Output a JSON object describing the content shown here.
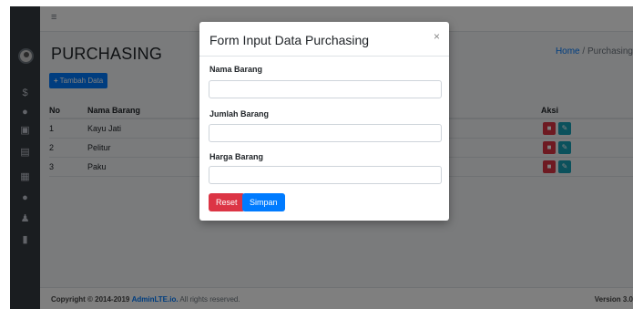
{
  "sidebar": {
    "icons": [
      "dollar-icon",
      "circle-icon",
      "money-icon",
      "box-icon",
      "calculator-icon",
      "info-icon",
      "users-icon",
      "file-icon"
    ]
  },
  "page": {
    "title": "PURCHASING",
    "breadcrumb_home": "Home",
    "breadcrumb_sep": "/",
    "breadcrumb_current": "Purchasing"
  },
  "toolbar": {
    "add_label": "Tambah Data"
  },
  "table": {
    "headers": {
      "no": "No",
      "nama": "Nama Barang",
      "aksi": "Aksi"
    },
    "rows": [
      {
        "no": "1",
        "nama": "Kayu Jati"
      },
      {
        "no": "2",
        "nama": "Pelitur"
      },
      {
        "no": "3",
        "nama": "Paku"
      }
    ]
  },
  "footer": {
    "copyright_prefix": "Copyright © 2014-2019",
    "brand": "AdminLTE.io.",
    "rights": "All rights reserved.",
    "version": "Version 3.0"
  },
  "modal": {
    "title": "Form Input Data Purchasing",
    "close": "×",
    "fields": [
      {
        "label": "Nama Barang",
        "value": "",
        "placeholder": ""
      },
      {
        "label": "Jumlah Barang",
        "value": "",
        "placeholder": ""
      },
      {
        "label": "Harga Barang",
        "value": "",
        "placeholder": ""
      }
    ],
    "reset_label": "Reset",
    "save_label": "Simpan"
  },
  "colors": {
    "primary": "#007bff",
    "danger": "#dc3545",
    "info": "#17a2b8",
    "sidebar": "#343a40"
  }
}
